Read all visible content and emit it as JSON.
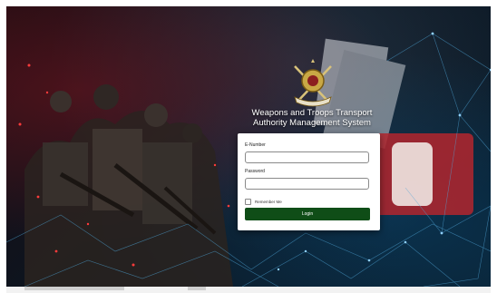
{
  "system_title_line1": "Weapons and Troops Transport",
  "system_title_line2": "Authority Management System",
  "login_form": {
    "email_label": "E-Number",
    "email_value": "",
    "password_label": "Password",
    "password_value": "",
    "remember_label": "Remember Me",
    "remember_checked": false,
    "submit_label": "Login"
  },
  "colors": {
    "primary_button": "#0f4d17",
    "background_dark": "#0c1520",
    "accent_red": "#b3262e",
    "network_blue": "#4fa6d8"
  },
  "icons": [
    "army-emblem-icon",
    "document-graphic",
    "hand-stop-graphic"
  ]
}
